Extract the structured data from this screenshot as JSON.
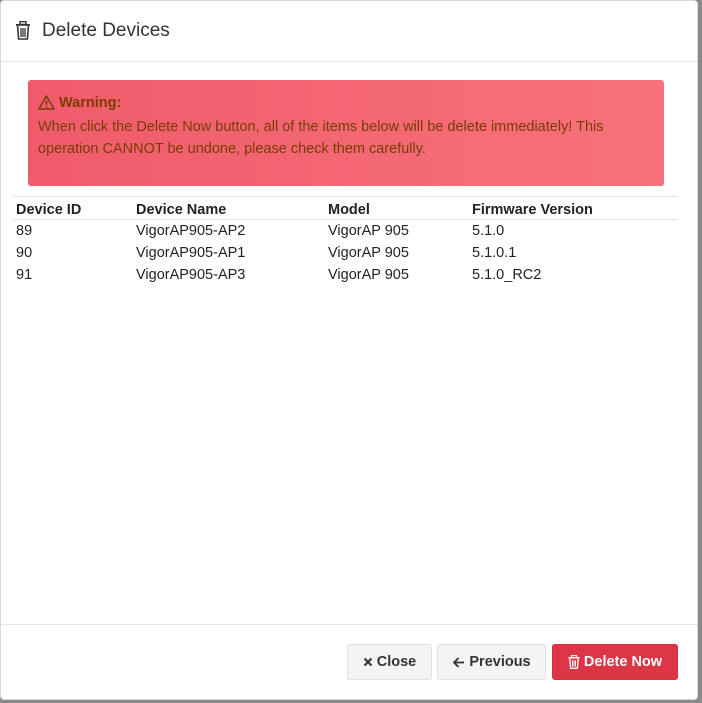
{
  "header": {
    "title": "Delete Devices",
    "icon": "trash-icon"
  },
  "alert": {
    "title": "Warning:",
    "icon": "warning-triangle-icon",
    "message": "When click the Delete Now button, all of the items below will be delete immediately! This operation CANNOT be undone, please check them carefully.",
    "colors": {
      "background_start": "#f05b6c",
      "background_end": "#f7727a",
      "text": "#7a3b00"
    }
  },
  "table": {
    "columns": [
      "Device ID",
      "Device Name",
      "Model",
      "Firmware Version"
    ],
    "rows": [
      [
        "89",
        "VigorAP905-AP2",
        "VigorAP 905",
        "5.1.0"
      ],
      [
        "90",
        "VigorAP905-AP1",
        "VigorAP 905",
        "5.1.0.1"
      ],
      [
        "91",
        "VigorAP905-AP3",
        "VigorAP 905",
        "5.1.0_RC2"
      ]
    ]
  },
  "footer": {
    "close_label": "Close",
    "close_icon": "times-icon",
    "previous_label": "Previous",
    "previous_icon": "arrow-left-icon",
    "delete_label": "Delete Now",
    "delete_icon": "trash-icon",
    "colors": {
      "danger": "#dc3545",
      "light": "#f4f4f4"
    }
  }
}
